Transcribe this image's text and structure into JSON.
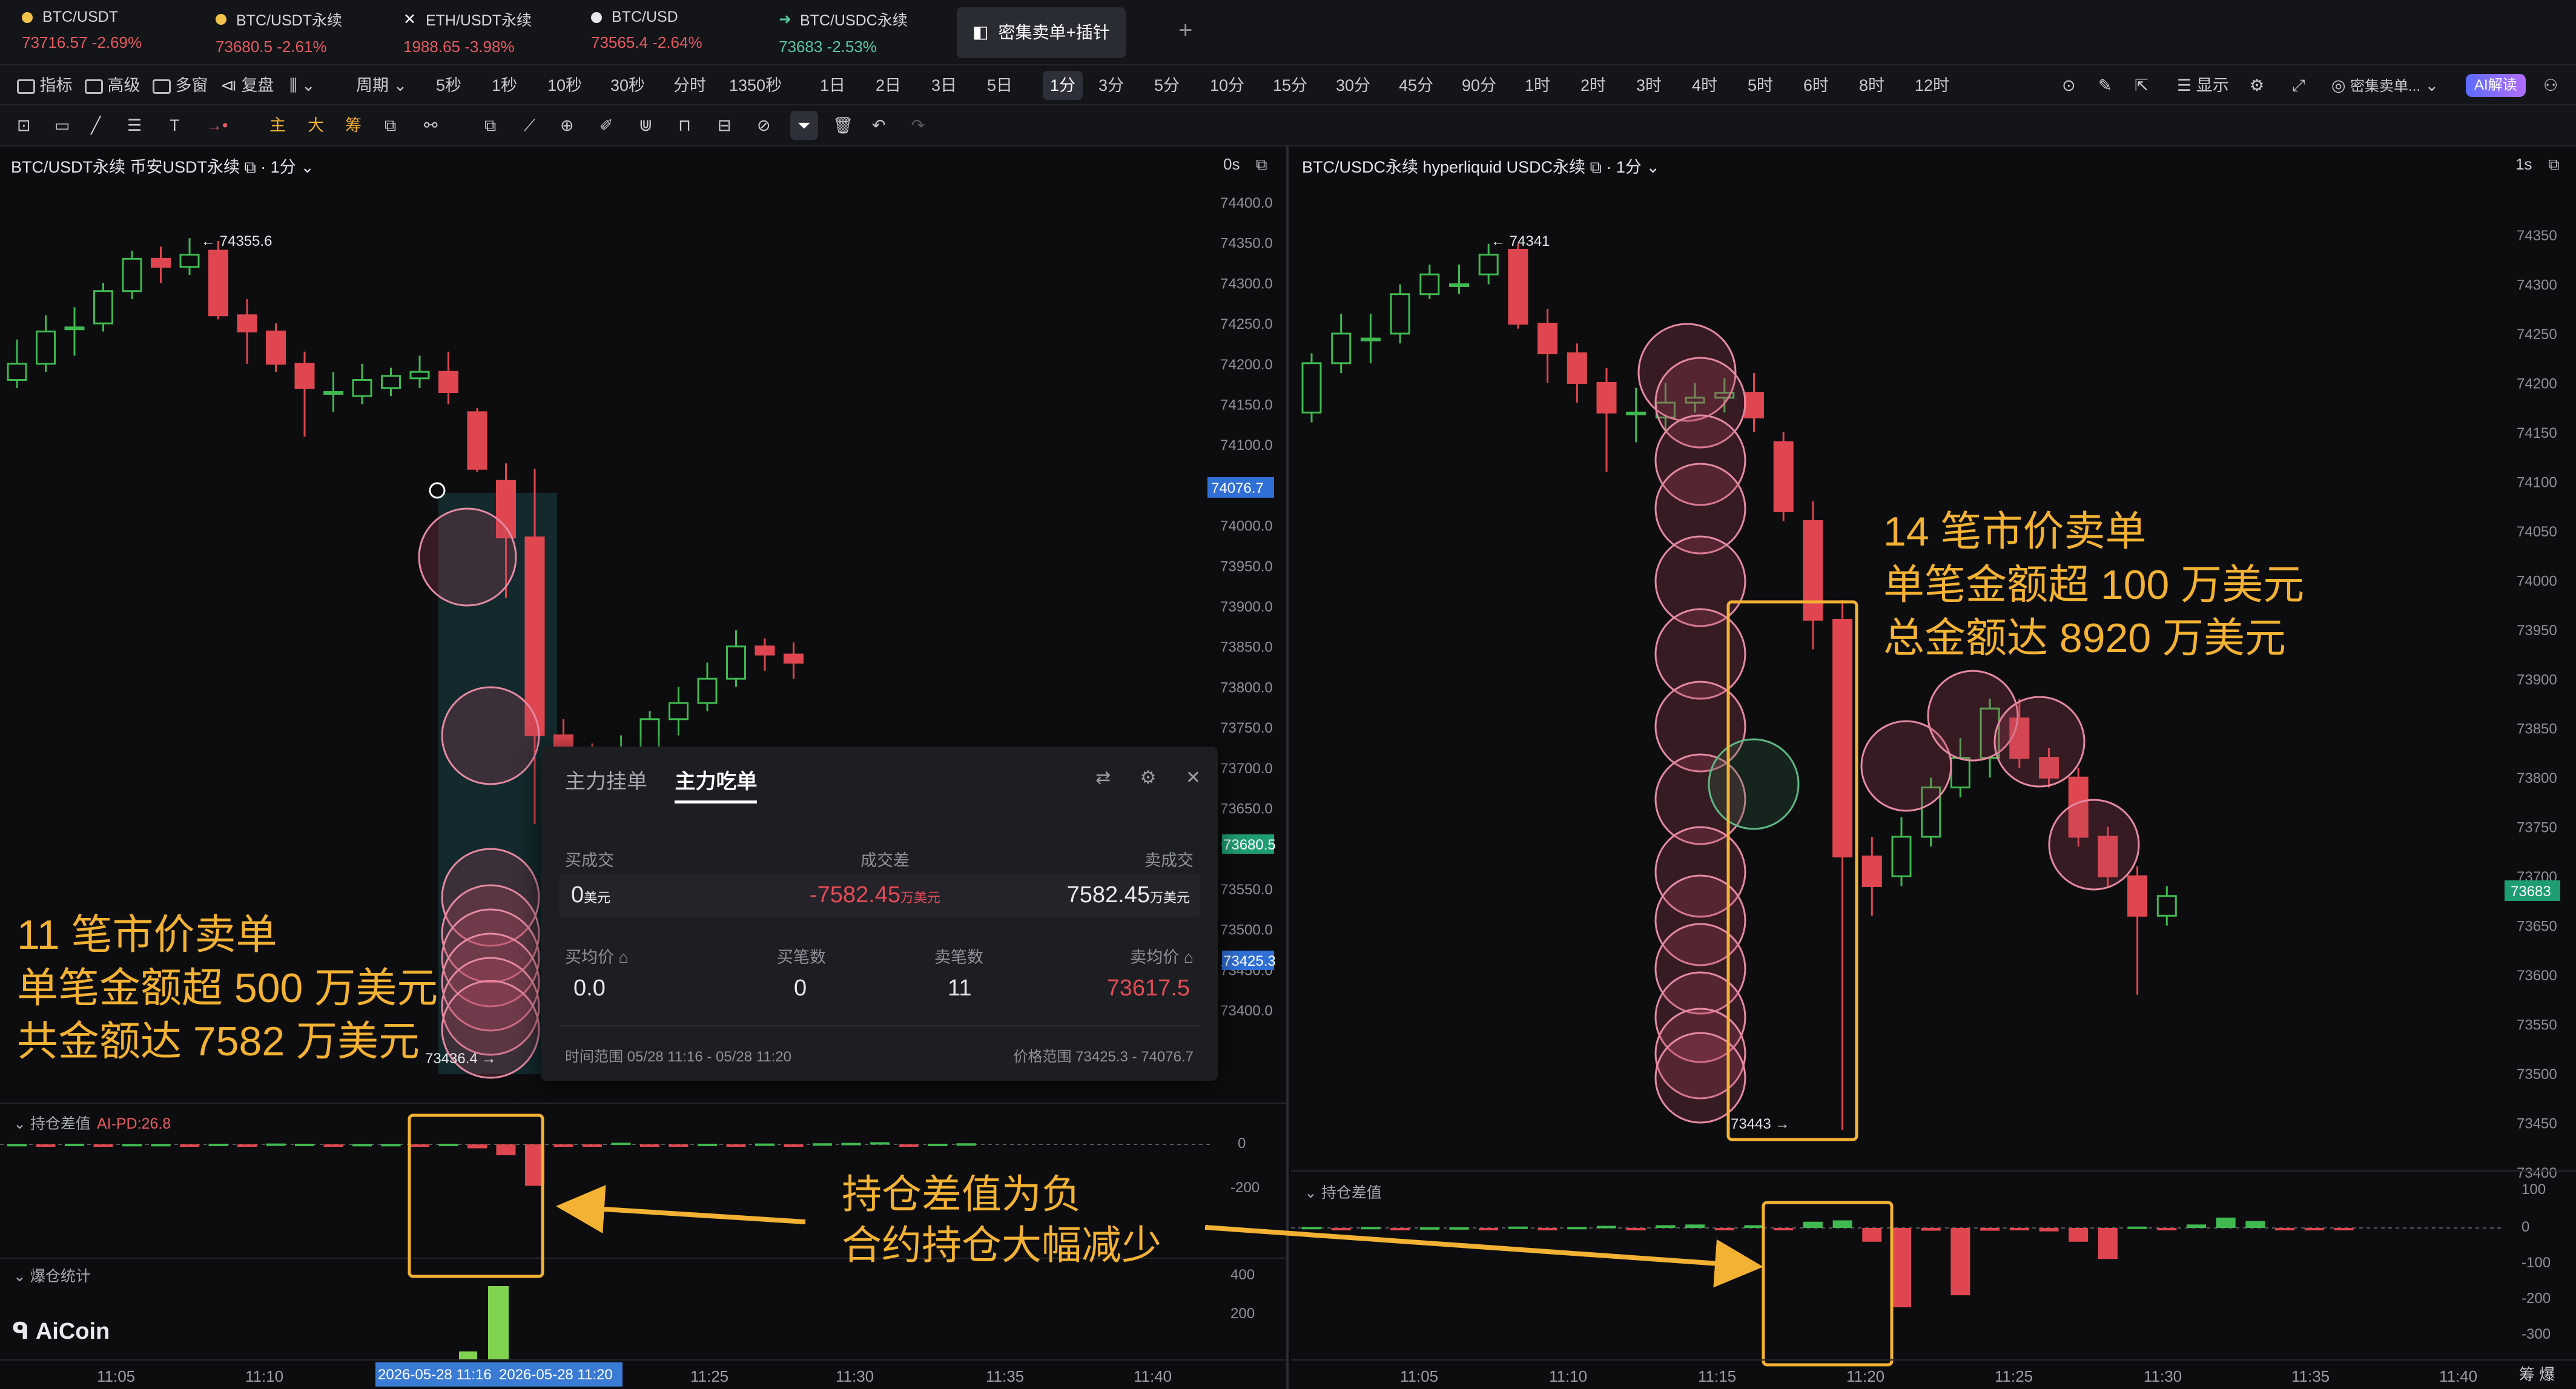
{
  "tabs": [
    {
      "symbol": "BTC/USDT",
      "price": "73716.57",
      "change": "-2.69%",
      "dot_color": "#f0c24a"
    },
    {
      "symbol": "BTC/USDT永续",
      "price": "73680.5",
      "change": "-2.61%",
      "dot_color": "#f0c24a"
    },
    {
      "symbol": "ETH/USDT永续",
      "price": "1988.65",
      "change": "-3.98%",
      "dot_color": "#ffffff"
    },
    {
      "symbol": "BTC/USD",
      "price": "73565.4",
      "change": "-2.64%",
      "dot_color": "#e6e7ea"
    },
    {
      "symbol": "BTC/USDC永续",
      "price": "73683",
      "change": "-2.53%",
      "dot_color": "#57c7a0"
    }
  ],
  "active_tab": "密集卖单+插针",
  "toolbar1": {
    "left": [
      "指标",
      "高级",
      "多窗",
      "复盘",
      "周期"
    ],
    "periods": [
      "5秒",
      "1秒",
      "10秒",
      "30秒",
      "分时",
      "1350秒",
      "1日",
      "2日",
      "3日",
      "5日",
      "1分",
      "3分",
      "5分",
      "10分",
      "15分",
      "30分",
      "45分",
      "90分",
      "1时",
      "2时",
      "3时",
      "4时",
      "5时",
      "6时",
      "8时",
      "12时"
    ],
    "selected_period": "1分",
    "display": "显示",
    "layout_name": "密集卖单...",
    "ai_label": "AI解读"
  },
  "toolbar2": {
    "tags": [
      "主",
      "大",
      "筹"
    ]
  },
  "left_chart": {
    "title": "BTC/USDT永续 币安USDT永续",
    "interval": "1分",
    "corner": "0s",
    "high_label": "74355.6",
    "low_label": "73436.4",
    "y_ticks": [
      "74400.0",
      "74350.0",
      "74300.0",
      "74250.0",
      "74200.0",
      "74150.0",
      "74100.0",
      "74050.0",
      "74000.0",
      "73950.0",
      "73900.0",
      "73850.0",
      "73800.0",
      "73750.0",
      "73700.0",
      "73650.0",
      "73600.0",
      "73550.0",
      "73500.0",
      "73450.0",
      "73400.0"
    ],
    "price_tag_high": "74076.7",
    "price_tag_mid": "73680.5",
    "price_tag_low": "73425.3",
    "oi_title": "持仓差值",
    "oi_sub": "AI-PD:26.8",
    "oi_ticks": [
      "0",
      "-200"
    ],
    "liq_title": "爆仓统计",
    "liq_ticks": [
      "400",
      "200"
    ],
    "x_ticks": [
      "11:05",
      "11:10",
      "11:25",
      "11:30",
      "11:35",
      "11:40"
    ],
    "x_sel_start": "2026-05-28 11:16",
    "x_sel_end": "2026-05-28 11:20"
  },
  "right_chart": {
    "title": "BTC/USDC永续 hyperliquid USDC永续",
    "interval": "1分",
    "corner": "1s",
    "high_label": "74341",
    "low_label": "73443",
    "y_ticks": [
      "74350",
      "74300",
      "74250",
      "74200",
      "74150",
      "74100",
      "74050",
      "74000",
      "73950",
      "73900",
      "73850",
      "73800",
      "73750",
      "73700",
      "73650",
      "73600",
      "73550",
      "73500",
      "73450",
      "73400"
    ],
    "price_tag": "73683",
    "oi_title": "持仓差值",
    "oi_ticks": [
      "100",
      "0",
      "-100",
      "-200",
      "-300"
    ],
    "x_ticks": [
      "11:05",
      "11:10",
      "11:15",
      "11:20",
      "11:25",
      "11:30",
      "11:35",
      "11:40"
    ],
    "corner_bottom": "筹 爆"
  },
  "annotations": {
    "left": [
      "11 笔市价卖单",
      "单笔金额超 500 万美元",
      "共金额达 7582 万美元"
    ],
    "right": [
      "14 笔市价卖单",
      "单笔金额超 100 万美元",
      "总金额达 8920 万美元"
    ],
    "middle": [
      "持仓差值为负",
      "合约持仓大幅减少"
    ]
  },
  "popup": {
    "tab1": "主力挂单",
    "tab2": "主力吃单",
    "col1": "买成交",
    "col2": "成交差",
    "col3": "卖成交",
    "buy_value": "0",
    "unit": "美元",
    "diff_value": "-7582.45",
    "diff_unit": "万美元",
    "sell_value": "7582.45",
    "sell_unit": "万美元",
    "row2_labels": [
      "买均价",
      "买笔数",
      "卖笔数",
      "卖均价"
    ],
    "row2_values": [
      "0.0",
      "0",
      "11",
      "73617.5"
    ],
    "time_range": "时间范围  05/28 11:16 - 05/28 11:20",
    "price_range": "价格范围  73425.3 - 74076.7"
  },
  "watermark": "AiCoin",
  "colors": {
    "up": "#3fb950",
    "down": "#e0464f",
    "annotation": "#f3b233"
  }
}
